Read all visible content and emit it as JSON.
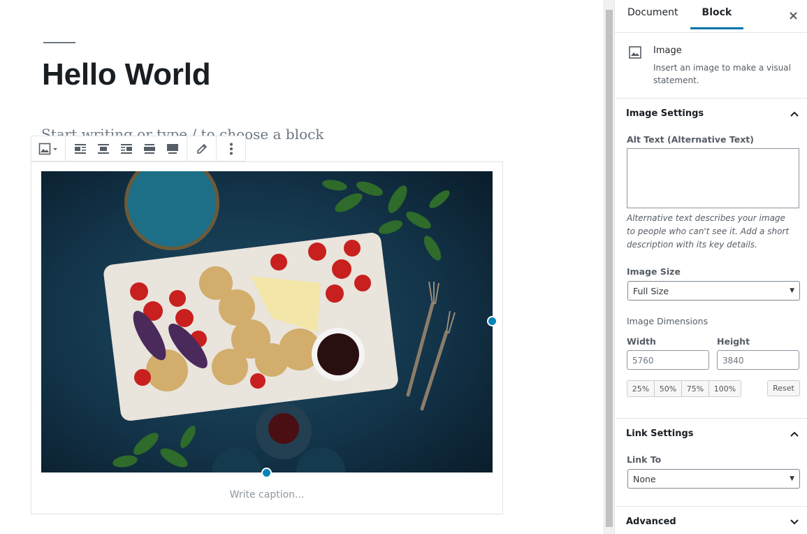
{
  "editor": {
    "title": "Hello World",
    "placeholder": "Start writing or type / to choose a block",
    "caption_placeholder": "Write caption..."
  },
  "toolbar": {
    "buttons": [
      {
        "icon": "image-icon"
      },
      {
        "icon": "align-left-icon"
      },
      {
        "icon": "align-center-icon"
      },
      {
        "icon": "align-right-icon"
      },
      {
        "icon": "wide-width-icon"
      },
      {
        "icon": "full-width-icon"
      },
      {
        "icon": "pencil-icon"
      },
      {
        "icon": "more-options-icon"
      }
    ]
  },
  "sidebar": {
    "tabs": [
      {
        "label": "Document",
        "active": false
      },
      {
        "label": "Block",
        "active": true
      }
    ],
    "close_icon": "close-icon",
    "block_card": {
      "icon": "image-icon",
      "title": "Image",
      "description": "Insert an image to make a visual statement."
    },
    "image_settings": {
      "title": "Image Settings",
      "alt_label": "Alt Text (Alternative Text)",
      "alt_value": "",
      "alt_help": "Alternative text describes your image to people who can't see it. Add a short description with its key details.",
      "size_label": "Image Size",
      "size_value": "Full Size",
      "dimensions_label": "Image Dimensions",
      "width_label": "Width",
      "width_placeholder": "5760",
      "height_label": "Height",
      "height_placeholder": "3840",
      "percent_buttons": [
        "25%",
        "50%",
        "75%",
        "100%"
      ],
      "reset_label": "Reset"
    },
    "link_settings": {
      "title": "Link Settings",
      "link_to_label": "Link To",
      "link_to_value": "None"
    },
    "advanced": {
      "title": "Advanced"
    }
  },
  "colors": {
    "accent": "#0073aa",
    "handle": "#0085ba",
    "text": "#191e23"
  }
}
